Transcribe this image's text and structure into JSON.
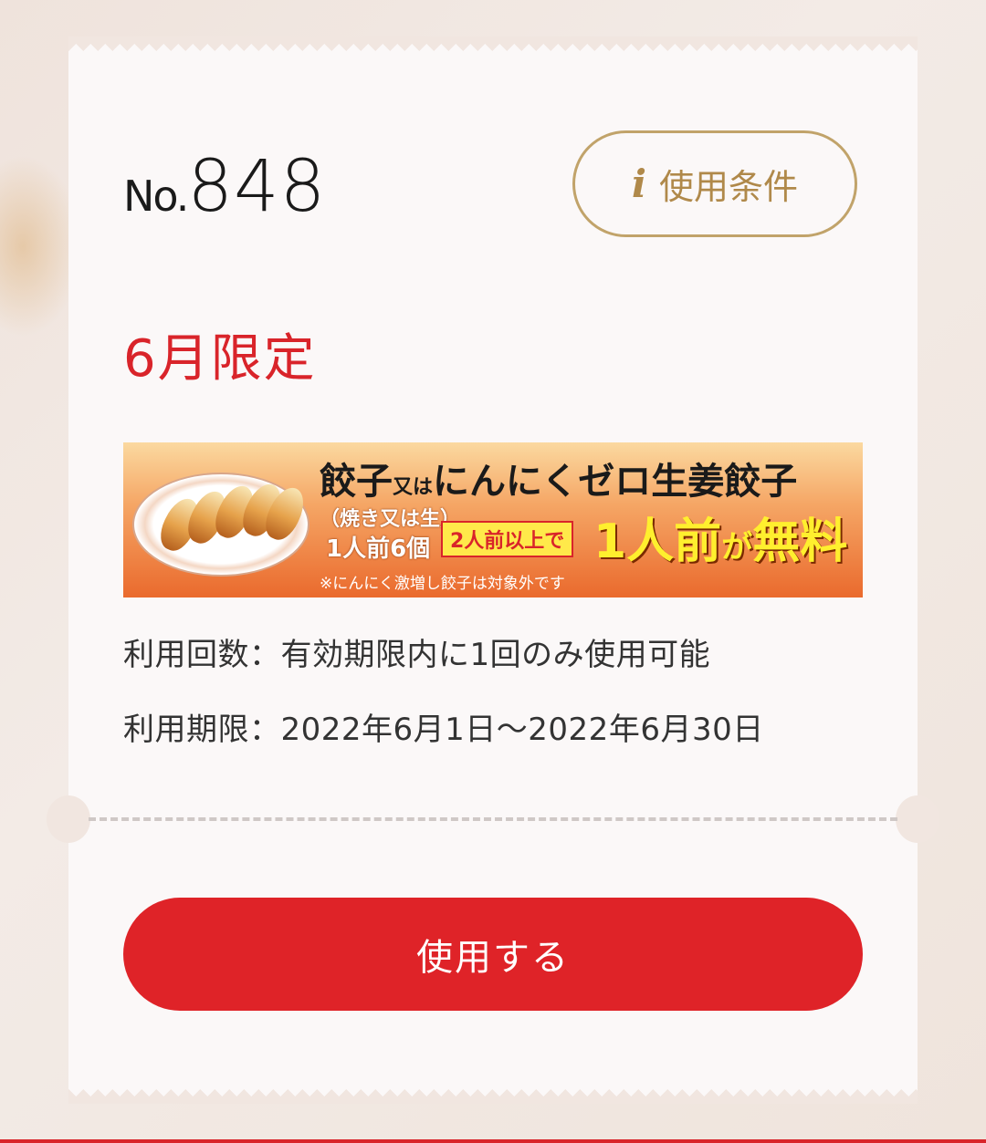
{
  "coupon": {
    "no_prefix": "No.",
    "number": "848",
    "conditions_label": "使用条件",
    "conditions_icon": "i",
    "limited_label": "6月限定",
    "usage_count": "利用回数：有効期限内に1回のみ使用可能",
    "usage_period": "利用期限：2022年6月1日〜2022年6月30日",
    "use_button": "使用する"
  },
  "banner": {
    "title_main": "餃子",
    "title_or": "又は",
    "title_rest": "にんにくゼロ生姜餃子",
    "type": "（焼き又は生）",
    "portion": "1人前6個",
    "condition": "2人前以上で",
    "free_a": "1人前",
    "free_b": "が",
    "free_c": "無料",
    "note": "※にんにく激増し餃子は対象外です"
  },
  "colors": {
    "accent_red": "#d9242a",
    "gold": "#b0894a",
    "ticket_bg": "#fbf8f8"
  }
}
